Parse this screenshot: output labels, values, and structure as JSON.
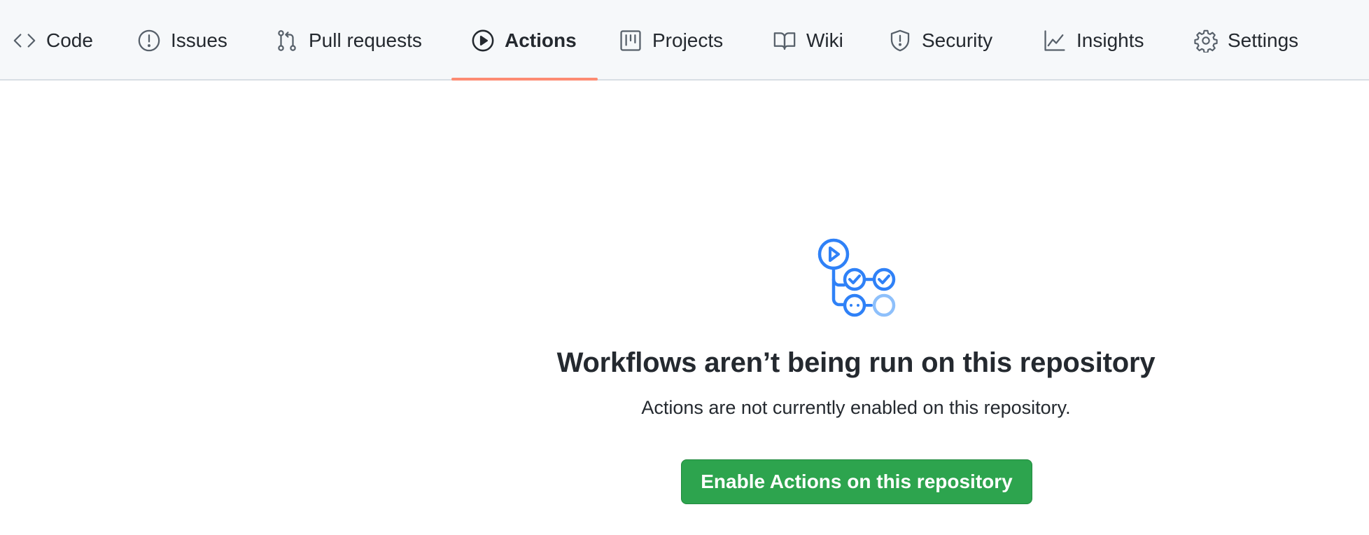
{
  "nav": {
    "tabs": [
      {
        "label": "Code",
        "icon": "code-icon",
        "active": false
      },
      {
        "label": "Issues",
        "icon": "issue-opened-icon",
        "active": false
      },
      {
        "label": "Pull requests",
        "icon": "git-pull-request-icon",
        "active": false
      },
      {
        "label": "Actions",
        "icon": "play-icon",
        "active": true
      },
      {
        "label": "Projects",
        "icon": "project-icon",
        "active": false
      },
      {
        "label": "Wiki",
        "icon": "book-icon",
        "active": false
      },
      {
        "label": "Security",
        "icon": "shield-icon",
        "active": false
      },
      {
        "label": "Insights",
        "icon": "graph-icon",
        "active": false
      },
      {
        "label": "Settings",
        "icon": "gear-icon",
        "active": false
      }
    ],
    "active_underline_color": "#fd8c73"
  },
  "empty_state": {
    "icon": "workflow-icon",
    "title": "Workflows aren’t being run on this repository",
    "subtitle": "Actions are not currently enabled on this repository.",
    "button_label": "Enable Actions on this repository",
    "button_color": "#2da44e",
    "icon_color": "#2f81f7"
  }
}
